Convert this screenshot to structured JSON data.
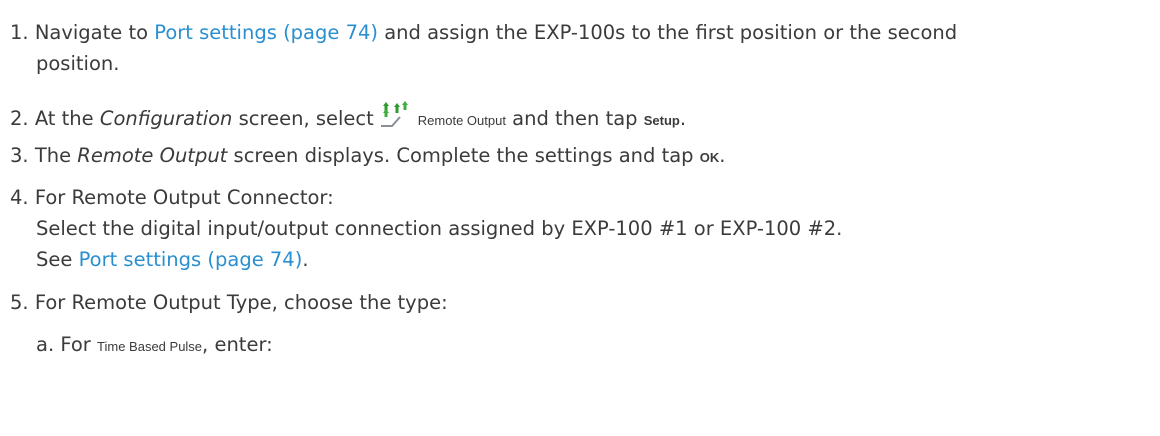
{
  "steps": [
    {
      "num": "1.",
      "pre": "Navigate to ",
      "link": "Port settings (page 74)",
      "post": " and assign the EXP-100s to the first position or the second",
      "cont": "position."
    },
    {
      "num": "2.",
      "pre": "At the ",
      "italic": "Configuration",
      "mid": " screen, select",
      "icon_name": "remote-output-icon",
      "ui_label": "Remote Output",
      "mid2": " and then tap ",
      "button": "Setup",
      "post": "."
    },
    {
      "num": "3.",
      "pre": "The ",
      "italic": "Remote Output",
      "mid": " screen displays. Complete the settings and tap ",
      "button": "OK",
      "post": "."
    },
    {
      "num": "4.",
      "text": "For Remote Output Connector:",
      "para1": "Select the digital input/output connection assigned by EXP-100 #1 or EXP-100 #2.",
      "para2_pre": "See ",
      "para2_link": "Port settings (page 74)",
      "para2_post": "."
    },
    {
      "num": "5.",
      "text": "For Remote Output Type, choose the type:"
    }
  ],
  "substep": {
    "letter": "a.",
    "pre": "For ",
    "ui_label": "Time Based Pulse",
    "post": ", enter:"
  },
  "colors": {
    "link": "#2a8fd0",
    "text": "#3b3b3b",
    "icon": "#2f9a2f"
  }
}
